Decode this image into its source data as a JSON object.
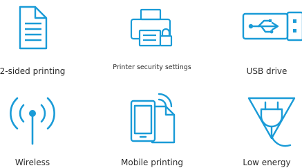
{
  "accent_color": "#1a9bd7",
  "features": [
    {
      "label": "2-sided printing",
      "icon": "document-icon"
    },
    {
      "label": "Printer security settings",
      "icon": "printer-lock-icon"
    },
    {
      "label": "USB drive",
      "icon": "usb-icon"
    },
    {
      "label": "Wireless",
      "icon": "wireless-icon"
    },
    {
      "label": "Mobile printing",
      "icon": "mobile-printing-icon"
    },
    {
      "label": "Low energy",
      "icon": "low-energy-icon"
    }
  ]
}
